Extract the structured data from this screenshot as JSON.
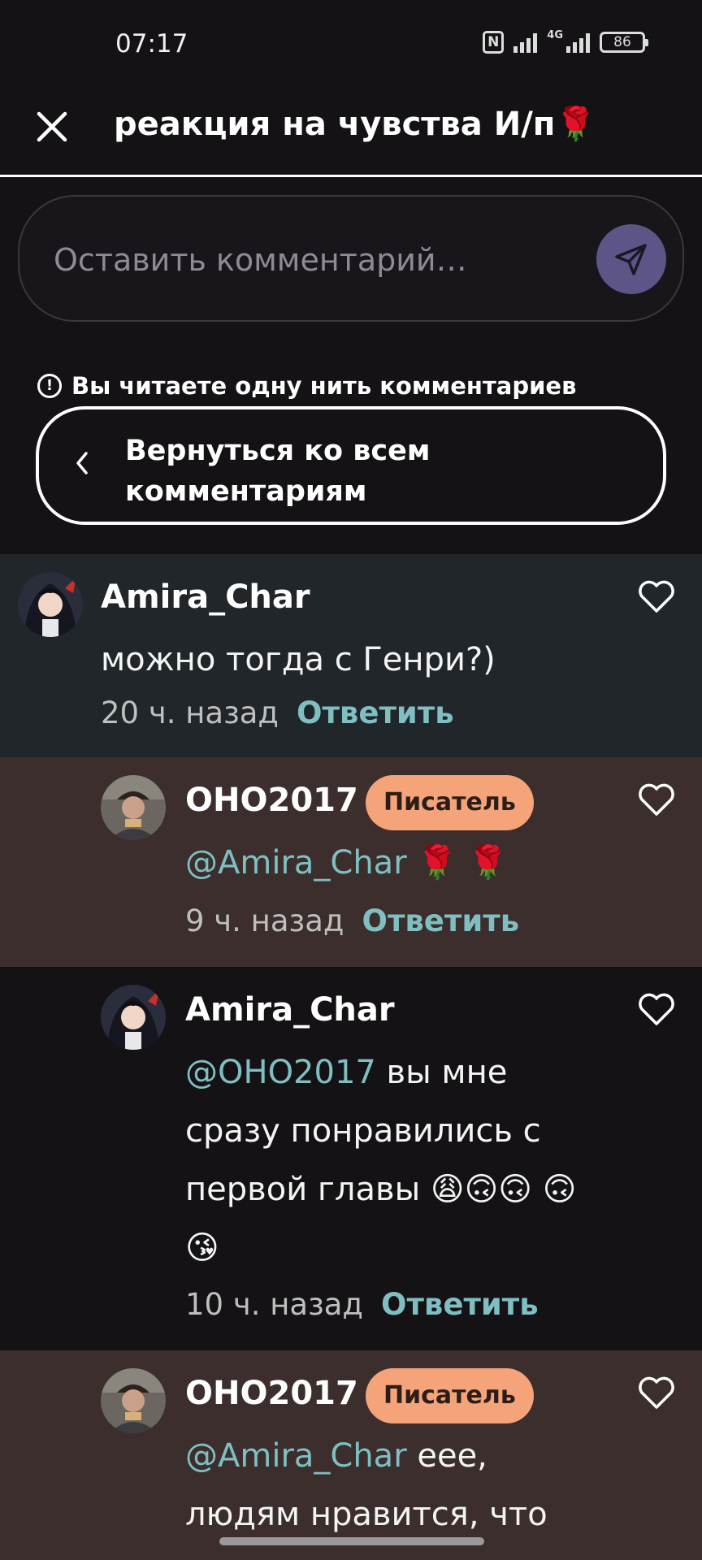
{
  "status": {
    "time": "07:17",
    "network": "4G",
    "battery": "86"
  },
  "header": {
    "title": "реакция на чувства И/п🌹"
  },
  "comment_input": {
    "placeholder": "Оставить комментарий…"
  },
  "thread": {
    "note": "Вы читаете одну нить комментариев",
    "back_label": "Вернуться ко всем комментариям"
  },
  "comments": [
    {
      "author": "Amira_Char",
      "badge": "",
      "mention": "",
      "text": "можно тогда с Генри?)",
      "time": "20 ч. назад",
      "reply": "Ответить"
    },
    {
      "author": "ОНО2017",
      "badge": "Писатель",
      "mention": "@Amira_Char",
      "text": " 🌹 🌹",
      "time": "9 ч. назад",
      "reply": "Ответить"
    },
    {
      "author": "Amira_Char",
      "badge": "",
      "mention": "@ОНО2017",
      "text": " вы мне сразу понравились с первой главы 😩🙃🙃 🙃😘",
      "time": "10 ч. назад",
      "reply": "Ответить"
    },
    {
      "author": "ОНО2017",
      "badge": "Писатель",
      "mention": "@Amira_Char",
      "text": " еее, людям нравится, что я",
      "time": "",
      "reply": ""
    }
  ],
  "colors": {
    "background": "#141215",
    "highlight_comment": "#202629",
    "author_comment": "#3c2e2d",
    "accent_link": "#7fbfc2",
    "writer_badge": "#f5a47a",
    "send_button": "#5d5587"
  }
}
